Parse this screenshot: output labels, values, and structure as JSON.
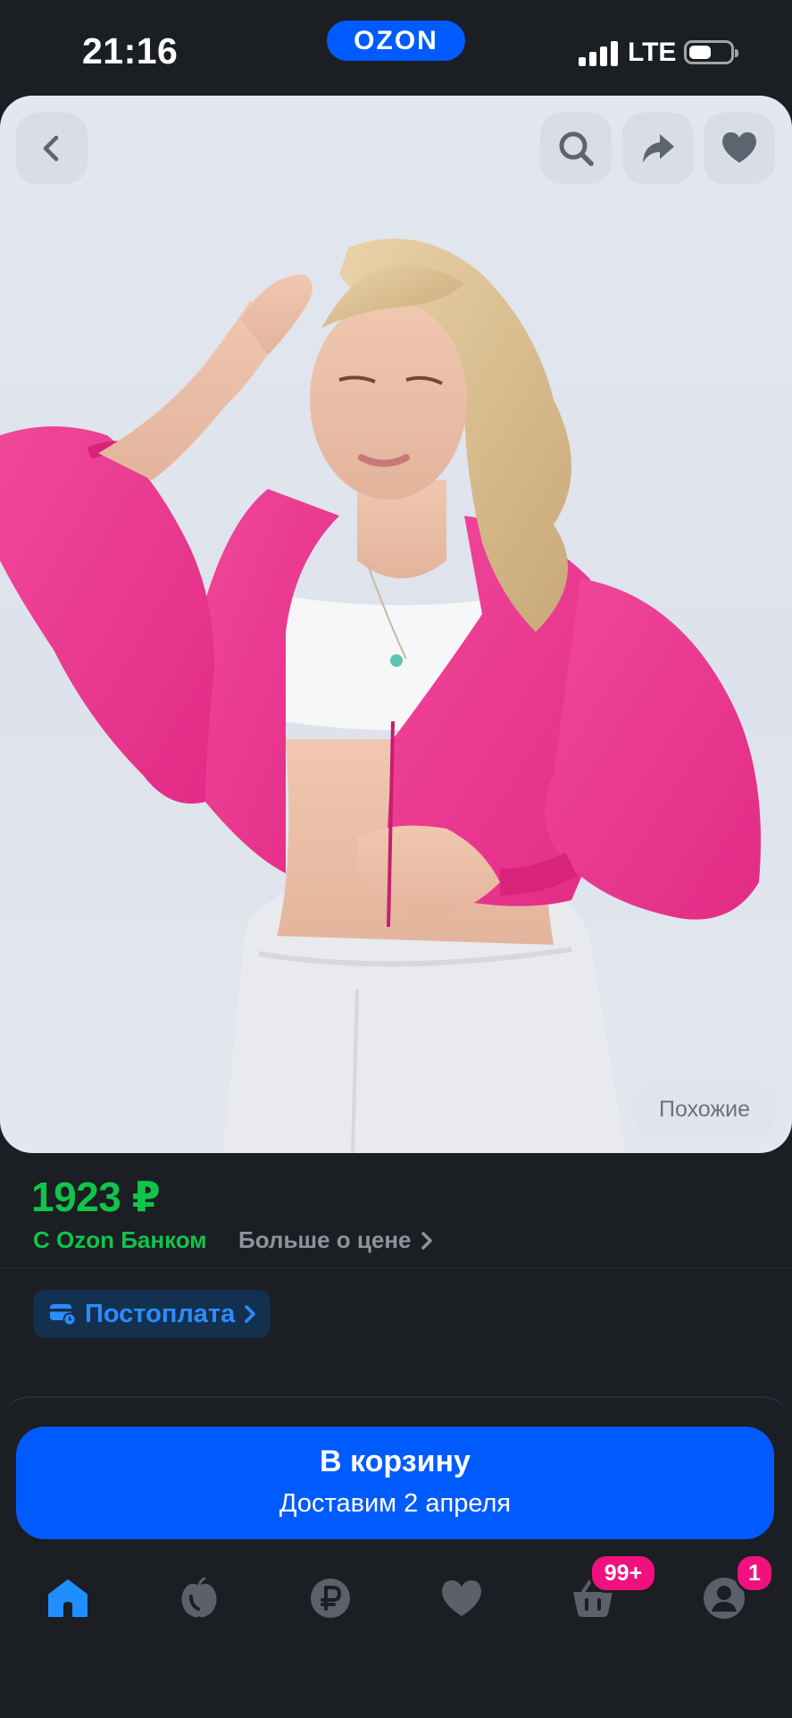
{
  "status_bar": {
    "time": "21:16",
    "brand": "OZON",
    "network": "LTE",
    "battery_level": 0.55
  },
  "product": {
    "image_alt": "",
    "similar_label": "Похожие"
  },
  "price": {
    "amount": "1923 ₽",
    "bank_label": "С Ozon Банком",
    "more_link": "Больше о цене"
  },
  "payment": {
    "postpay_label": "Постоплата"
  },
  "cart_button": {
    "label": "В корзину",
    "delivery": "Доставим 2 апреля"
  },
  "tabbar": {
    "items": [
      {
        "icon": "home-icon",
        "active": true
      },
      {
        "icon": "fresh-icon",
        "active": false
      },
      {
        "icon": "finance-icon",
        "active": false
      },
      {
        "icon": "favorites-icon",
        "active": false
      },
      {
        "icon": "cart-icon",
        "active": false,
        "badge": "99+"
      },
      {
        "icon": "profile-icon",
        "active": false,
        "badge": "1"
      }
    ]
  },
  "colors": {
    "brand": "#005bff",
    "price_green": "#10c44c",
    "badge_pink": "#f1117e",
    "postpay_blue": "#2c8cff",
    "background": "#1b1e22"
  }
}
